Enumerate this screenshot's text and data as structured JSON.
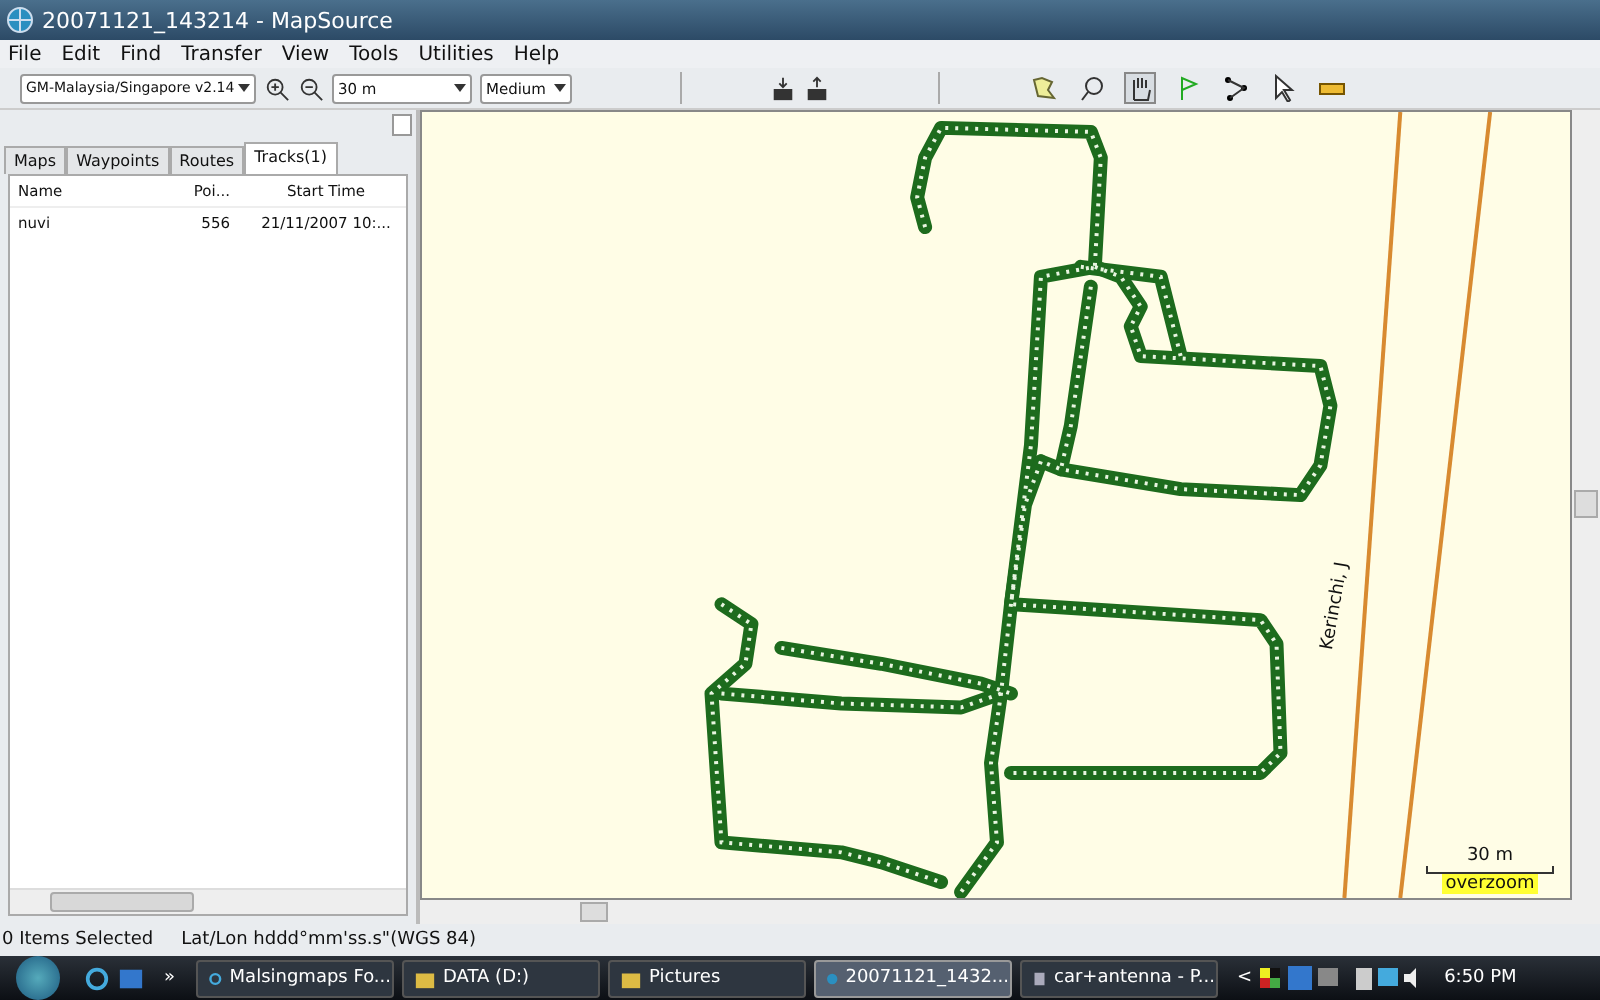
{
  "window": {
    "title": "20071121_143214 - MapSource"
  },
  "menu": [
    "File",
    "Edit",
    "Find",
    "Transfer",
    "View",
    "Tools",
    "Utilities",
    "Help"
  ],
  "toolbar": {
    "map_product": "GM-Malaysia/Singapore v2.14",
    "zoom": "30 m",
    "detail": "Medium",
    "tools": [
      {
        "kind": "map",
        "selected": false
      },
      {
        "kind": "zoom",
        "selected": false
      },
      {
        "kind": "hand",
        "selected": true
      },
      {
        "kind": "waypoint",
        "selected": false
      },
      {
        "kind": "route",
        "selected": false
      },
      {
        "kind": "select",
        "selected": false
      },
      {
        "kind": "measure",
        "selected": false
      }
    ]
  },
  "tabs": [
    {
      "label": "Maps",
      "selected": false
    },
    {
      "label": "Waypoints",
      "selected": false
    },
    {
      "label": "Routes",
      "selected": false
    },
    {
      "label": "Tracks(1)",
      "selected": true
    }
  ],
  "table": {
    "columns": [
      "Name",
      "Poi...",
      "Start Time"
    ],
    "rows": [
      [
        "nuvi",
        "556",
        "21/11/2007 10:..."
      ]
    ]
  },
  "map": {
    "road_label": "Kerinchi, J",
    "scale": "30 m",
    "overzoom": "overzoom"
  },
  "status_bar": [
    "0 Items Selected",
    "Lat/Lon hddd°mm'ss.s\"(WGS 84)"
  ],
  "taskbar": {
    "overflow": "»",
    "buttons": [
      {
        "label": "Malsingmaps Fo...",
        "kind": "browser",
        "selected": false
      },
      {
        "label": "DATA (D:)",
        "kind": "folder",
        "selected": false
      },
      {
        "label": "Pictures",
        "kind": "folder",
        "selected": false
      },
      {
        "label": "20071121_1432...",
        "kind": "globe",
        "selected": true
      },
      {
        "label": "car+antenna - P...",
        "kind": "doc",
        "selected": false
      }
    ],
    "tray_arrow": "<",
    "clock": "6:50 PM"
  }
}
